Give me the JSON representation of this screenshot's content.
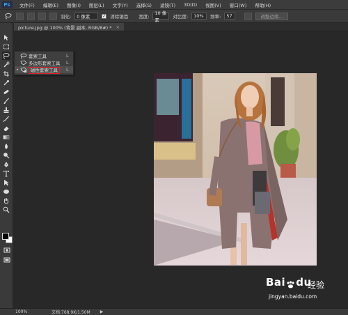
{
  "app": {
    "logo": "Ps"
  },
  "menu": [
    "文件(F)",
    "编辑(E)",
    "图像(I)",
    "图层(L)",
    "文字(Y)",
    "选择(S)",
    "滤镜(T)",
    "3D(D)",
    "视图(V)",
    "窗口(W)",
    "帮助(H)"
  ],
  "options": {
    "feather_label": "羽化:",
    "feather_value": "0 像素",
    "antialias_label": "消除锯齿",
    "antialias_checked": true,
    "width_label": "宽度:",
    "width_value": "10 像素",
    "contrast_label": "对比度:",
    "contrast_value": "10%",
    "frequency_label": "频率:",
    "frequency_value": "57",
    "refine_edge_label": "调整边缘..."
  },
  "document": {
    "tab_title": "picture.jpg @ 100% (背景 副本, RGB/8#) *",
    "close": "×"
  },
  "flyout": {
    "items": [
      {
        "label": "套索工具",
        "shortcut": "L",
        "icon": "lasso-icon",
        "selected": false
      },
      {
        "label": "多边形套索工具",
        "shortcut": "L",
        "icon": "polygonal-lasso-icon",
        "selected": false
      },
      {
        "label": "磁性套索工具",
        "shortcut": "L",
        "icon": "magnetic-lasso-icon",
        "selected": true
      }
    ]
  },
  "tools": [
    "move-tool-icon",
    "marquee-tool-icon",
    "lasso-tool-icon",
    "quick-select-tool-icon",
    "crop-tool-icon",
    "eyedropper-tool-icon",
    "healing-brush-tool-icon",
    "brush-tool-icon",
    "clone-stamp-tool-icon",
    "history-brush-tool-icon",
    "eraser-tool-icon",
    "gradient-tool-icon",
    "blur-tool-icon",
    "dodge-tool-icon",
    "pen-tool-icon",
    "type-tool-icon",
    "path-select-tool-icon",
    "shape-tool-icon",
    "hand-tool-icon",
    "zoom-tool-icon"
  ],
  "status": {
    "zoom": "100%",
    "doc_info": "文档:768.9K/1.50M",
    "arrow": "▶"
  },
  "watermark": {
    "brand": "Bai",
    "brand2": "du",
    "cn": "经验",
    "url": "jingyan.baidu.com"
  },
  "colors": {
    "accent_red": "#e0222a",
    "ps_blue": "#2fa3f0",
    "panel": "#3a3a3a",
    "canvas": "#282828"
  }
}
